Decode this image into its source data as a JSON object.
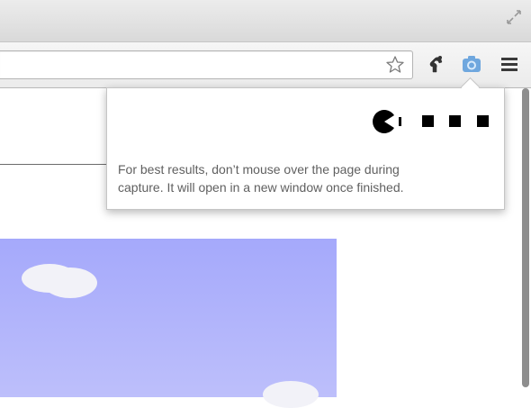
{
  "browser": {
    "icons": {
      "fullscreen": "fullscreen-icon",
      "bookmark": "star-icon",
      "extension_1": "puzzle-extension-icon",
      "extension_2": "camera-icon",
      "menu": "hamburger-menu-icon"
    },
    "colors": {
      "camera_icon": "#6fa7de",
      "titlebar": "#e2e2e2",
      "toolbar": "#efefef"
    },
    "address_value": ""
  },
  "popup": {
    "message_line1": "For best results, don’t mouse over the page during",
    "message_line2": "capture. It will open in a new window once finished.",
    "progress_icon": "pacman-loading-icon"
  },
  "page": {
    "colors": {
      "sky": "#a8acfb",
      "cloud": "#f2f2f8"
    }
  }
}
